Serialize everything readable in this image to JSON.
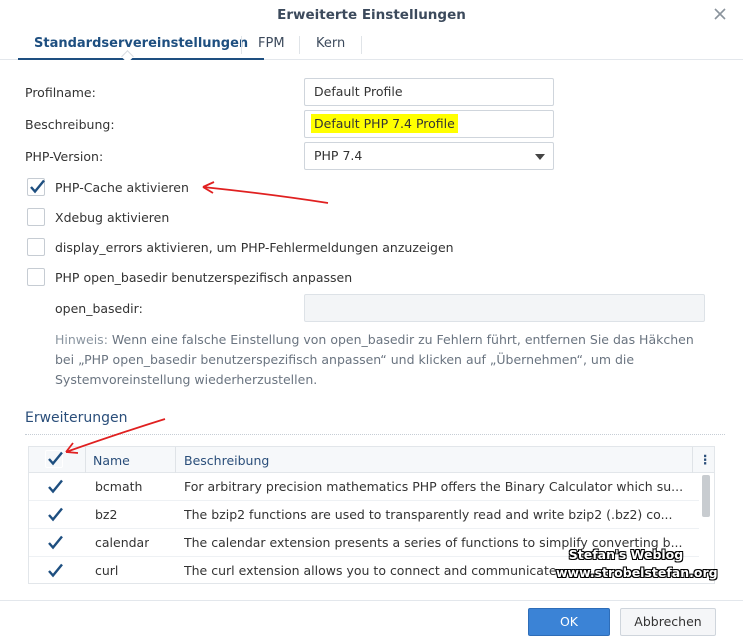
{
  "dialog": {
    "title": "Erweiterte Einstellungen",
    "close_icon": "close-icon"
  },
  "tabs": [
    {
      "label": "Standardservereinstellungen",
      "active": true
    },
    {
      "label": "FPM",
      "active": false
    },
    {
      "label": "Kern",
      "active": false
    }
  ],
  "form": {
    "profile_name_label": "Profilname:",
    "profile_name_value": "Default Profile",
    "description_label": "Beschreibung:",
    "description_value": "Default PHP 7.4 Profile",
    "php_version_label": "PHP-Version:",
    "php_version_value": "PHP 7.4"
  },
  "options": [
    {
      "label": "PHP-Cache aktivieren",
      "checked": true
    },
    {
      "label": "Xdebug aktivieren",
      "checked": false
    },
    {
      "label": "display_errors aktivieren, um PHP-Fehlermeldungen anzuzeigen",
      "checked": false
    },
    {
      "label": "PHP open_basedir benutzerspezifisch anpassen",
      "checked": false
    }
  ],
  "open_basedir": {
    "label": "open_basedir:",
    "value": ""
  },
  "hint": {
    "key": "Hinweis:",
    "text": "Wenn eine falsche Einstellung von open_basedir zu Fehlern führt, entfernen Sie das Häkchen bei „PHP open_basedir benutzerspezifisch anpassen“ und klicken auf „Übernehmen“, um die Systemvoreinstellung wiederherzustellen."
  },
  "extensions": {
    "section_title": "Erweiterungen",
    "columns": {
      "name": "Name",
      "description": "Beschreibung",
      "menu": "⋮"
    },
    "header_checked": true,
    "rows": [
      {
        "name": "bcmath",
        "description": "For arbitrary precision mathematics PHP offers the Binary Calculator which su...",
        "checked": true
      },
      {
        "name": "bz2",
        "description": "The bzip2 functions are used to transparently read and write bzip2 (.bz2) co...",
        "checked": true
      },
      {
        "name": "calendar",
        "description": "The calendar extension presents a series of functions to simplify converting b...",
        "checked": true
      },
      {
        "name": "curl",
        "description": "The curl extension allows you to connect and communicate",
        "checked": true
      }
    ]
  },
  "watermark": {
    "line1": "Stefan's Weblog",
    "line2": "www.strobelstefan.org"
  },
  "buttons": {
    "ok": "OK",
    "cancel": "Abbrechen"
  },
  "colors": {
    "accent": "#1e4f80",
    "primary_button": "#3b83d6",
    "highlight": "#ffff00",
    "arrow": "#e02020"
  }
}
